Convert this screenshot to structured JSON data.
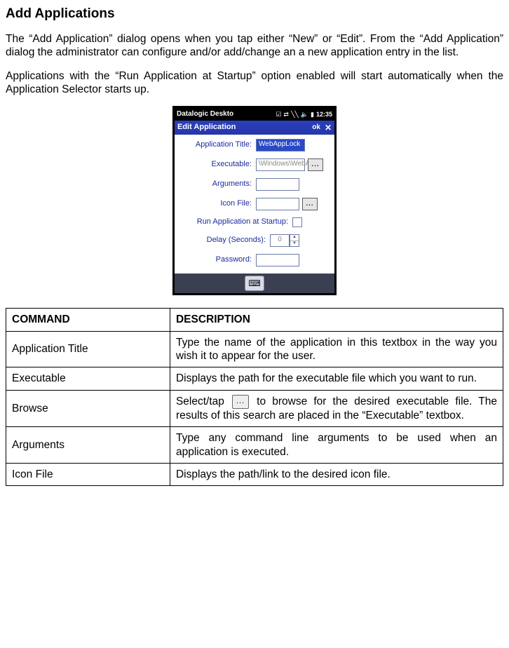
{
  "page": {
    "heading": "Add Applications",
    "para1": "The “Add Application” dialog opens when you tap either “New” or “Edit”. From the “Add Application” dialog the administrator can configure and/or add/change an a new application entry in the list.",
    "para2": "Applications with the “Run Application at Startup” option enabled will start automatically when the Application Selector starts up."
  },
  "screenshot": {
    "statusbar": {
      "title": "Datalogic Deskto",
      "time": "12:35"
    },
    "titlebar": {
      "title": "Edit Application",
      "ok": "ok",
      "close": "✕"
    },
    "fields": {
      "appTitle": {
        "label": "Application Title:",
        "value": "WebAppLock"
      },
      "executable": {
        "label": "Executable:",
        "value": "\\Windows\\WebA",
        "browse": "..."
      },
      "arguments": {
        "label": "Arguments:",
        "value": ""
      },
      "iconFile": {
        "label": "Icon File:",
        "value": "",
        "browse": "..."
      },
      "runStartup": {
        "label": "Run Application at Startup:"
      },
      "delay": {
        "label": "Delay (Seconds):",
        "value": "0"
      },
      "password": {
        "label": "Password:",
        "value": ""
      }
    }
  },
  "table": {
    "headers": {
      "cmd": "COMMAND",
      "desc": "DESCRIPTION"
    },
    "rows": [
      {
        "cmd": "Application Title",
        "desc": "Type the name of the application in this textbox in the way you wish it to appear for the user."
      },
      {
        "cmd": "Executable",
        "desc": "Displays the path for the executable file which you want to run."
      },
      {
        "cmd": "Browse",
        "desc_pre": "Select/tap ",
        "btn": "...",
        "desc_post": " to browse for the desired executable file. The results of this search are placed in the “Executable” textbox."
      },
      {
        "cmd": "Arguments",
        "desc": "Type any command line arguments to be used when an application is executed."
      },
      {
        "cmd": "Icon File",
        "desc": "Displays the path/link to the desired icon file."
      }
    ]
  }
}
